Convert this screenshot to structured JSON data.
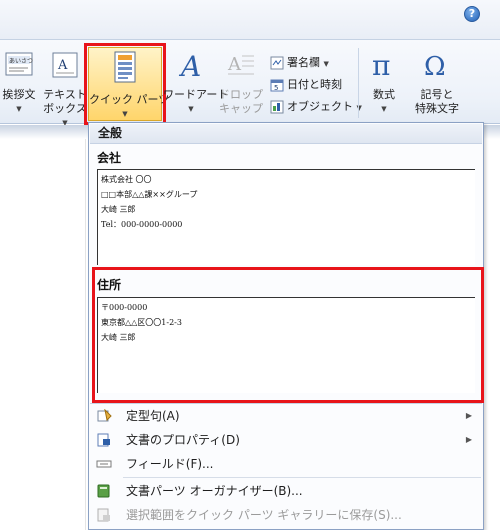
{
  "ribbon": {
    "greeting": {
      "line1": "挨拶文",
      "line2": ""
    },
    "textbox": {
      "line1": "テキスト",
      "line2": "ボックス"
    },
    "quickparts": {
      "label": "クイック パーツ"
    },
    "wordart": {
      "label": "ワードアート"
    },
    "dropcap": {
      "line1": "ドロップ",
      "line2": "キャップ"
    },
    "signature": {
      "label": "署名欄"
    },
    "datetime": {
      "label": "日付と時刻"
    },
    "object": {
      "label": "オブジェクト"
    },
    "equation": {
      "label": "数式"
    },
    "symbol": {
      "line1": "記号と",
      "line2": "特殊文字"
    }
  },
  "gallery": {
    "header": "全般",
    "entries": [
      {
        "title": "会社",
        "lines": [
          "株式会社 〇〇",
          "□□本部△△課××グループ",
          "大崎 三郎",
          "Tel：000-0000-0000"
        ]
      },
      {
        "title": "住所",
        "lines": [
          "〒000-0000",
          "東京都△△区〇〇1-2-3",
          "大崎 三郎"
        ]
      }
    ]
  },
  "menu": {
    "autotext": "定型句(A)",
    "docprop": "文書のプロパティ(D)",
    "field": "フィールド(F)...",
    "organizer": "文書パーツ オーガナイザー(B)...",
    "save": "選択範囲をクイック パーツ ギャラリーに保存(S)..."
  },
  "colors": {
    "highlight": "#e8141a",
    "selected_button": "#ffd56b"
  }
}
